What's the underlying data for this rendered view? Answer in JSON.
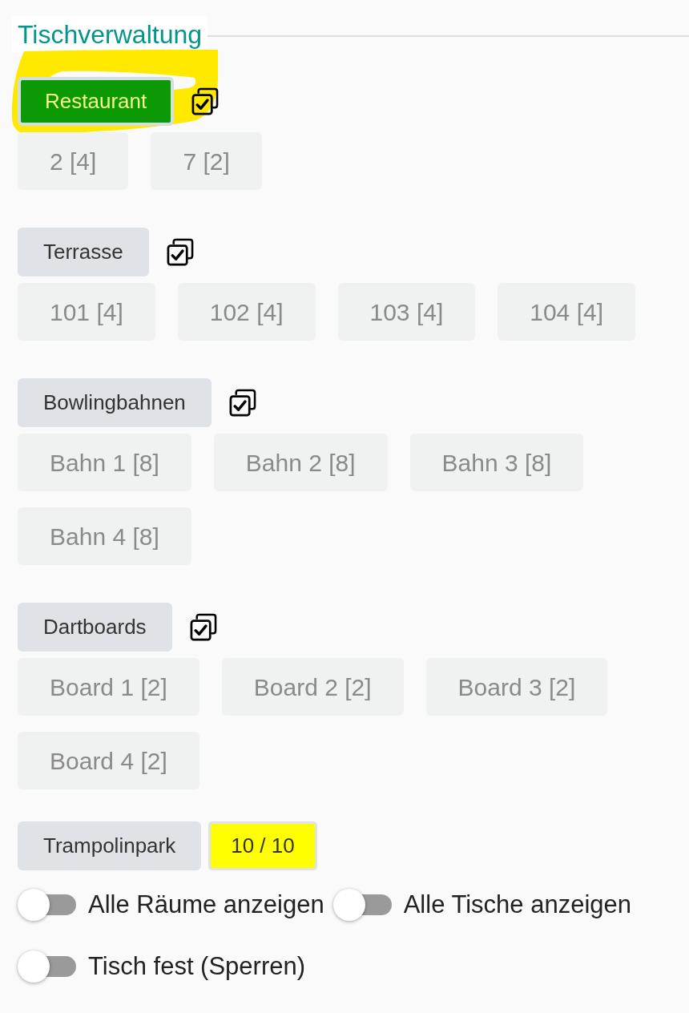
{
  "legend": "Tischverwaltung",
  "rooms": [
    {
      "kind": "tables",
      "name": "Restaurant",
      "selected": true,
      "tables": [
        "2 [4]",
        "7 [2]"
      ]
    },
    {
      "kind": "tables",
      "name": "Terrasse",
      "selected": false,
      "tables": [
        "101 [4]",
        "102 [4]",
        "103 [4]",
        "104 [4]"
      ]
    },
    {
      "kind": "tables",
      "name": "Bowlingbahnen",
      "selected": false,
      "tables": [
        "Bahn 1 [8]",
        "Bahn 2 [8]",
        "Bahn 3 [8]",
        "Bahn 4 [8]"
      ]
    },
    {
      "kind": "tables",
      "name": "Dartboards",
      "selected": false,
      "tables": [
        "Board 1 [2]",
        "Board 2 [2]",
        "Board 3 [2]",
        "Board 4 [2]"
      ]
    },
    {
      "kind": "counter",
      "name": "Trampolinpark",
      "selected": false,
      "counter": "10 / 10"
    }
  ],
  "toggles": [
    {
      "label": "Alle Räume anzeigen",
      "on": false
    },
    {
      "label": "Alle Tische anzeigen",
      "on": false
    },
    {
      "label": "Tisch fest (Sperren)",
      "on": false
    }
  ]
}
